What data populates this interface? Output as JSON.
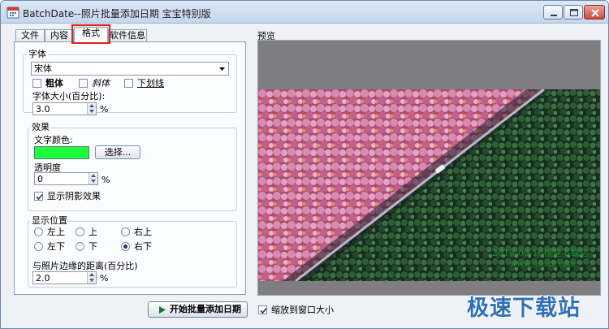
{
  "window": {
    "title": "BatchDate--照片批量添加日期 宝宝特别版"
  },
  "tabs": [
    {
      "label": "文件"
    },
    {
      "label": "内容"
    },
    {
      "label": "格式"
    },
    {
      "label": "软件信息"
    }
  ],
  "format": {
    "font_group_label": "字体",
    "font_value": "宋体",
    "bold_label": "粗体",
    "italic_label": "斜体",
    "underline_label": "下划线",
    "size_label": "字体大小(百分比):",
    "size_value": "3.0",
    "size_unit": "%",
    "effects_group_label": "效果",
    "text_color_label": "文字颜色:",
    "text_color": "#1bff3c",
    "choose_button": "选择...",
    "opacity_label": "透明度",
    "opacity_value": "0",
    "opacity_unit": "%",
    "shadow_label": "显示阴影效果",
    "shadow_checked": true,
    "position_group_label": "显示位置",
    "positions": {
      "top_left": "左上",
      "top": "上",
      "top_right": "右上",
      "bottom_left": "左下",
      "bottom": "下",
      "bottom_right": "右下"
    },
    "selected_position": "右下",
    "margin_label": "与照片边缘的距离(百分比)",
    "margin_value": "2.0",
    "margin_unit": "%"
  },
  "preview": {
    "label": "预览",
    "stamp_date": "2018-09-10极速下载站",
    "stamp_url": "www.jisuxz.com",
    "fit_label": "缩放到窗口大小",
    "fit_checked": true
  },
  "actions": {
    "start_button": "开始批量添加日期"
  },
  "watermark": {
    "text": "极速下载站"
  }
}
